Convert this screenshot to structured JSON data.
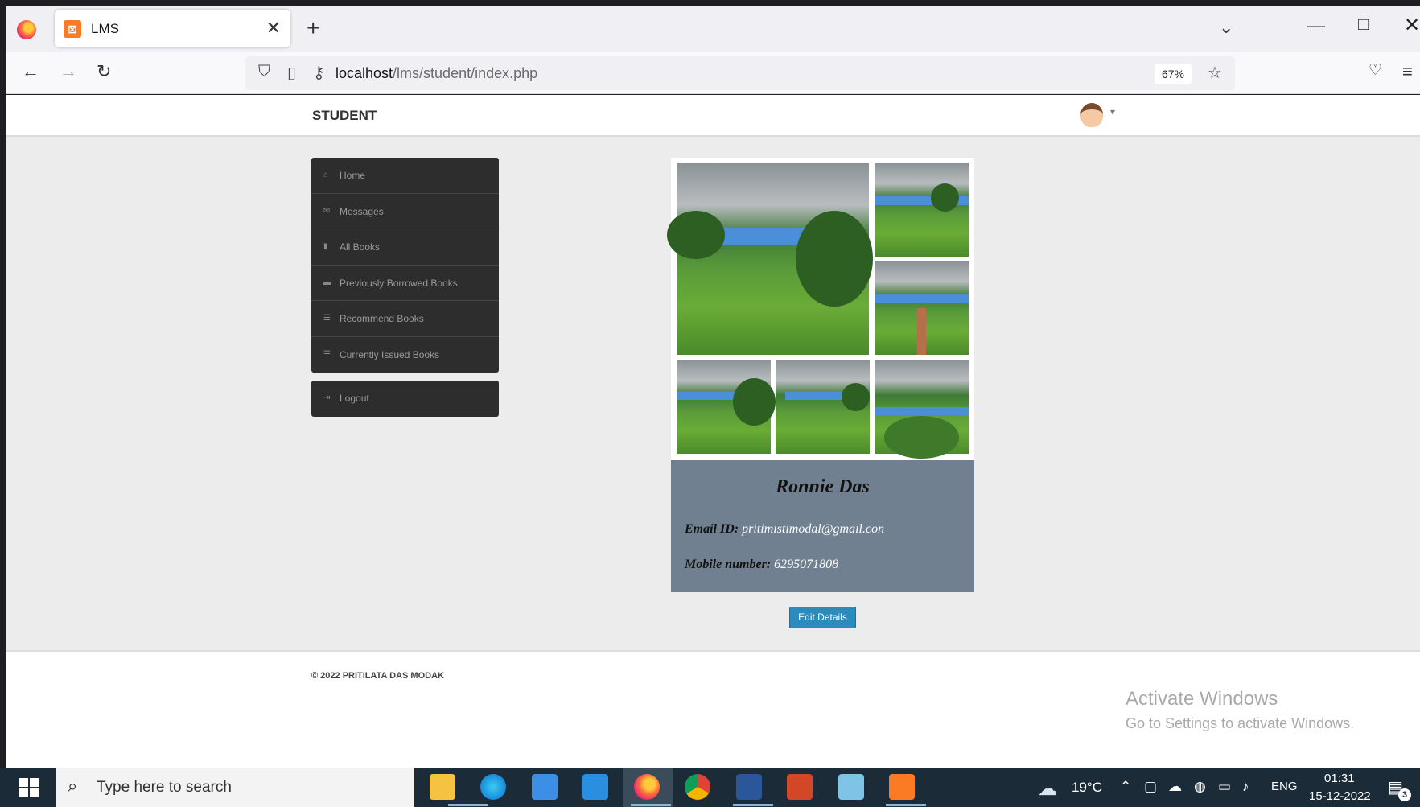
{
  "browser": {
    "tab_title": "LMS",
    "tab_close": "✕",
    "new_tab": "+",
    "url_host": "localhost",
    "url_path": "/lms/student/index.php",
    "zoom": "67%"
  },
  "header": {
    "brand": "STUDENT",
    "avatar_caret": "▾"
  },
  "sidebar": {
    "items": [
      {
        "label": "Home",
        "icon": "home-icon",
        "glyph": "⌂"
      },
      {
        "label": "Messages",
        "icon": "inbox-icon",
        "glyph": "✉"
      },
      {
        "label": "All Books",
        "icon": "book-icon",
        "glyph": "▮"
      },
      {
        "label": "Previously Borrowed Books",
        "icon": "books-icon",
        "glyph": "▬"
      },
      {
        "label": "Recommend Books",
        "icon": "list-icon",
        "glyph": "☰"
      },
      {
        "label": "Currently Issued Books",
        "icon": "list-icon",
        "glyph": "☰"
      }
    ],
    "logout": {
      "label": "Logout",
      "icon": "logout-icon",
      "glyph": "⇥"
    }
  },
  "profile": {
    "name": "Ronnie Das",
    "email_label": "Email ID:",
    "email_value": "pritimistimodal@gmail.con",
    "mobile_label": "Mobile number:",
    "mobile_value": "6295071808",
    "edit_button": "Edit Details"
  },
  "footer": {
    "copyright": "© 2022 PRITILATA DAS MODAK",
    "activate_title": "Activate Windows",
    "activate_sub": "Go to Settings to activate Windows."
  },
  "taskbar": {
    "search_placeholder": "Type here to search",
    "temperature": "19°C",
    "language": "ENG",
    "time": "01:31",
    "date": "15-12-2022",
    "notification_count": "3"
  },
  "colors": {
    "sidebar_bg": "#2d2d2d",
    "info_card_bg": "#708090",
    "edit_button_bg": "#2c8bbd",
    "taskbar_bg": "#1c2b38"
  }
}
